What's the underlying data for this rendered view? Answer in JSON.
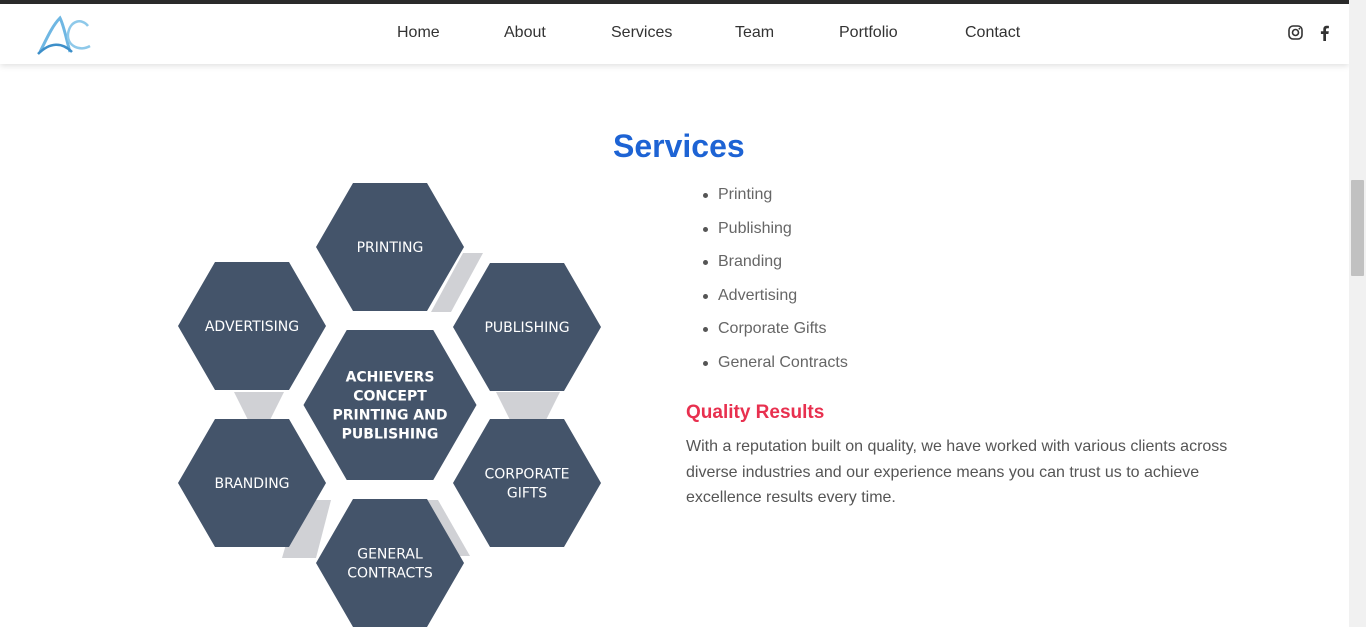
{
  "brand": {
    "logo_text": "AC"
  },
  "nav": {
    "items": [
      {
        "label": "Home"
      },
      {
        "label": "About"
      },
      {
        "label": "Services"
      },
      {
        "label": "Team"
      },
      {
        "label": "Portfolio"
      },
      {
        "label": "Contact"
      }
    ],
    "social": [
      "instagram-icon",
      "facebook-icon"
    ]
  },
  "services": {
    "title": "Services",
    "diagram": {
      "center": [
        "ACHIEVERS",
        "CONCEPT",
        "PRINTING AND",
        "PUBLISHING"
      ],
      "printing": [
        "PRINTING"
      ],
      "publishing": [
        "PUBLISHING"
      ],
      "corporate": [
        "CORPORATE",
        "GIFTS"
      ],
      "general": [
        "GENERAL",
        "CONTRACTS"
      ],
      "branding": [
        "BRANDING"
      ],
      "advertising": [
        "ADVERTISING"
      ]
    },
    "list": [
      "Printing",
      "Publishing",
      "Branding",
      "Advertising",
      "Corporate Gifts",
      "General Contracts"
    ],
    "quality": {
      "title": "Quality Results",
      "text": "With a reputation built on quality, we have worked with various clients across diverse industries and our experience means you can trust us to achieve excellence results every time."
    }
  },
  "colors": {
    "hex_fill": "#44546a",
    "connector": "#d0d1d5",
    "title_blue": "#1d63d4",
    "accent_red": "#e8304f"
  }
}
